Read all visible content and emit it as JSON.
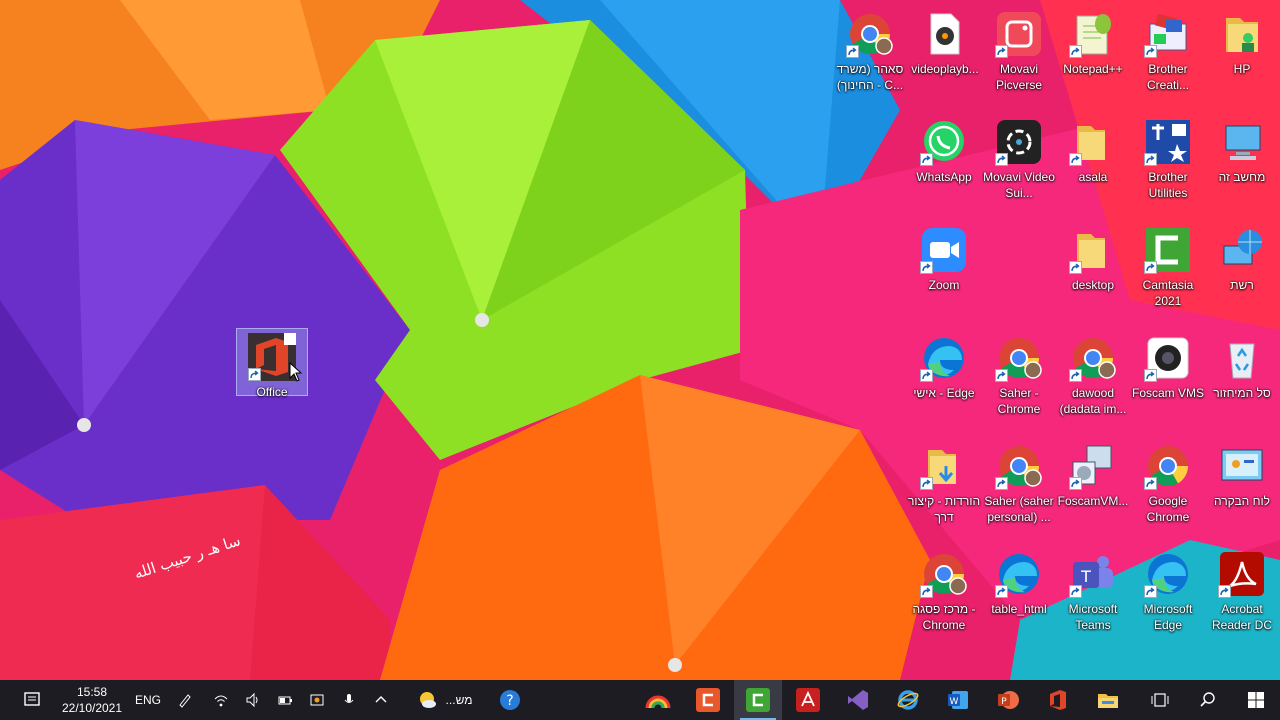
{
  "desktop": {
    "wallpaper_text": "سا هـ ر حبيب الله",
    "icons": [
      {
        "id": "chrome-saher-hachinuch",
        "label": "סאהר (משרד החינוך) - C...",
        "icon": "chrome-profile-icon"
      },
      {
        "id": "videoplayback",
        "label": "videoplayb...",
        "icon": "media-file-icon"
      },
      {
        "id": "movavi-picverse",
        "label": "Movavi Picverse",
        "icon": "movavi-picverse-icon"
      },
      {
        "id": "notepadpp",
        "label": "Notepad++",
        "icon": "notepad-plus-plus-icon"
      },
      {
        "id": "brother-creative",
        "label": "Brother Creati...",
        "icon": "brother-creative-icon"
      },
      {
        "id": "hp",
        "label": "HP",
        "icon": "user-folder-icon"
      },
      {
        "id": "whatsapp",
        "label": "WhatsApp",
        "icon": "whatsapp-icon"
      },
      {
        "id": "movavi-video-suite",
        "label": "Movavi Video Sui...",
        "icon": "movavi-video-suite-icon"
      },
      {
        "id": "asala",
        "label": "asala",
        "icon": "folder-icon"
      },
      {
        "id": "brother-utilities",
        "label": "Brother Utilities",
        "icon": "brother-utilities-icon"
      },
      {
        "id": "this-pc",
        "label": "מחשב זה",
        "icon": "computer-icon"
      },
      {
        "id": "zoom",
        "label": "Zoom",
        "icon": "zoom-icon"
      },
      {
        "id": "desktop-folder",
        "label": "desktop",
        "icon": "folder-icon"
      },
      {
        "id": "camtasia",
        "label": "Camtasia 2021",
        "icon": "camtasia-icon"
      },
      {
        "id": "network",
        "label": "רשת",
        "icon": "network-globe-icon"
      },
      {
        "id": "office",
        "label": "Office",
        "icon": "office-icon"
      },
      {
        "id": "edge-personal",
        "label": "אישי - Edge",
        "icon": "edge-icon"
      },
      {
        "id": "saher-chrome",
        "label": "Saher - Chrome",
        "icon": "chrome-profile-icon"
      },
      {
        "id": "dawood-chrome",
        "label": "dawood (dadata im...",
        "icon": "chrome-profile-icon"
      },
      {
        "id": "foscam-vms",
        "label": "Foscam VMS",
        "icon": "camera-icon"
      },
      {
        "id": "recycle-bin",
        "label": "סל המיחזור",
        "icon": "recycle-bin-icon"
      },
      {
        "id": "downloads-shortcut",
        "label": "הורדות - קיצור דרך",
        "icon": "downloads-folder-icon"
      },
      {
        "id": "saher-personal-chrome",
        "label": "Saher (saher personal) ...",
        "icon": "chrome-profile-icon"
      },
      {
        "id": "foscamvm",
        "label": "FoscamVM...",
        "icon": "installer-icon"
      },
      {
        "id": "google-chrome",
        "label": "Google Chrome",
        "icon": "chrome-icon"
      },
      {
        "id": "control-panel",
        "label": "לוח הבקרה",
        "icon": "control-panel-icon"
      },
      {
        "id": "markaz-chrome",
        "label": "מרכז פסגה - Chrome",
        "icon": "chrome-profile-icon"
      },
      {
        "id": "table-html",
        "label": "table_html",
        "icon": "edge-icon"
      },
      {
        "id": "teams",
        "label": "Microsoft Teams",
        "icon": "teams-icon"
      },
      {
        "id": "ms-edge",
        "label": "Microsoft Edge",
        "icon": "edge-icon"
      },
      {
        "id": "acrobat",
        "label": "Acrobat Reader DC",
        "icon": "acrobat-icon"
      }
    ]
  },
  "taskbar": {
    "time": "15:58",
    "date": "22/10/2021",
    "language": "ENG",
    "weather_label": "...מש",
    "tray": [
      "notification-icon",
      "pen-icon",
      "wifi-icon",
      "volume-icon",
      "battery-icon",
      "security-icon",
      "microphone-icon",
      "chevron-up-icon",
      "weather-icon",
      "help-icon"
    ],
    "apps": [
      "rainbow-app-icon",
      "camtasia-recorder-icon",
      "camtasia-icon",
      "acrobat-icon",
      "visual-studio-icon",
      "internet-explorer-icon",
      "word-icon",
      "powerpoint-icon",
      "office-icon",
      "file-explorer-icon",
      "task-view-icon",
      "search-icon",
      "windows-start-icon"
    ]
  }
}
